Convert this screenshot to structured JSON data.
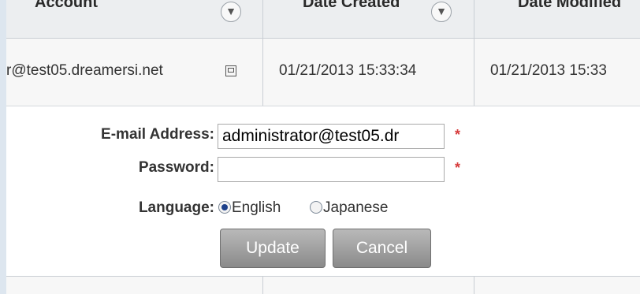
{
  "table": {
    "columns": [
      {
        "label": "Account"
      },
      {
        "label": "Date Created"
      },
      {
        "label": "Date Modified"
      }
    ],
    "row": {
      "account": "r@test05.dreamersi.net",
      "date_created": "01/21/2013 15:33:34",
      "date_modified": "01/21/2013 15:33"
    }
  },
  "form": {
    "email_label": "E-mail Address:",
    "email_value": "administrator@test05.dr",
    "password_label": "Password:",
    "password_value": "",
    "language_label": "Language:",
    "language_options": [
      "English",
      "Japanese"
    ],
    "language_selected": "English",
    "required_marker": "*",
    "update_label": "Update",
    "cancel_label": "Cancel"
  },
  "icons": {
    "filter": "filter-icon",
    "popup": "external-window-icon"
  }
}
